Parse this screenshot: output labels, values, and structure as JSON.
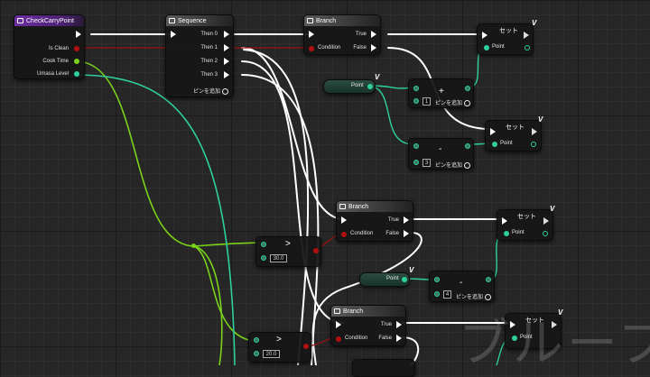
{
  "colors": {
    "exec": "#ffffff",
    "bool": "#b01010",
    "int": "#7ad31a",
    "float": "#2ecf9e",
    "function_header": "#6d2fa4"
  },
  "function_node": {
    "title": "CheckCarryPoint",
    "outputs": [
      "Is Clean",
      "Cook Time",
      "Umasa Level"
    ]
  },
  "sequence_node": {
    "title": "Sequence",
    "outputs": [
      "Then 0",
      "Then 1",
      "Then 2",
      "Then 3"
    ],
    "add_pin": "ピンを追加"
  },
  "branch_nodes": [
    {
      "title": "Branch",
      "condition": "Condition",
      "true_label": "True",
      "false_label": "False"
    },
    {
      "title": "Branch",
      "condition": "Condition",
      "true_label": "True",
      "false_label": "False"
    },
    {
      "title": "Branch",
      "condition": "Condition",
      "true_label": "True",
      "false_label": "False"
    }
  ],
  "set_nodes": [
    {
      "title": "セット",
      "pin": "Point"
    },
    {
      "title": "セット",
      "pin": "Point"
    },
    {
      "title": "セット",
      "pin": "Point"
    },
    {
      "title": "セット",
      "pin": "Point"
    }
  ],
  "var_nodes": [
    {
      "label": "Point"
    },
    {
      "label": "Point"
    }
  ],
  "math_nodes": [
    {
      "op": "+",
      "value": "1",
      "add_pin": "ピンを追加"
    },
    {
      "op": "-",
      "value": "3",
      "add_pin": "ピンを追加"
    },
    {
      "op": "-",
      "value": "4",
      "add_pin": "ピンを追加"
    }
  ],
  "compare_nodes": [
    {
      "op": ">",
      "value": "30.0"
    },
    {
      "op": ">",
      "value": "20.0"
    }
  ],
  "watermark": "ブループリン"
}
